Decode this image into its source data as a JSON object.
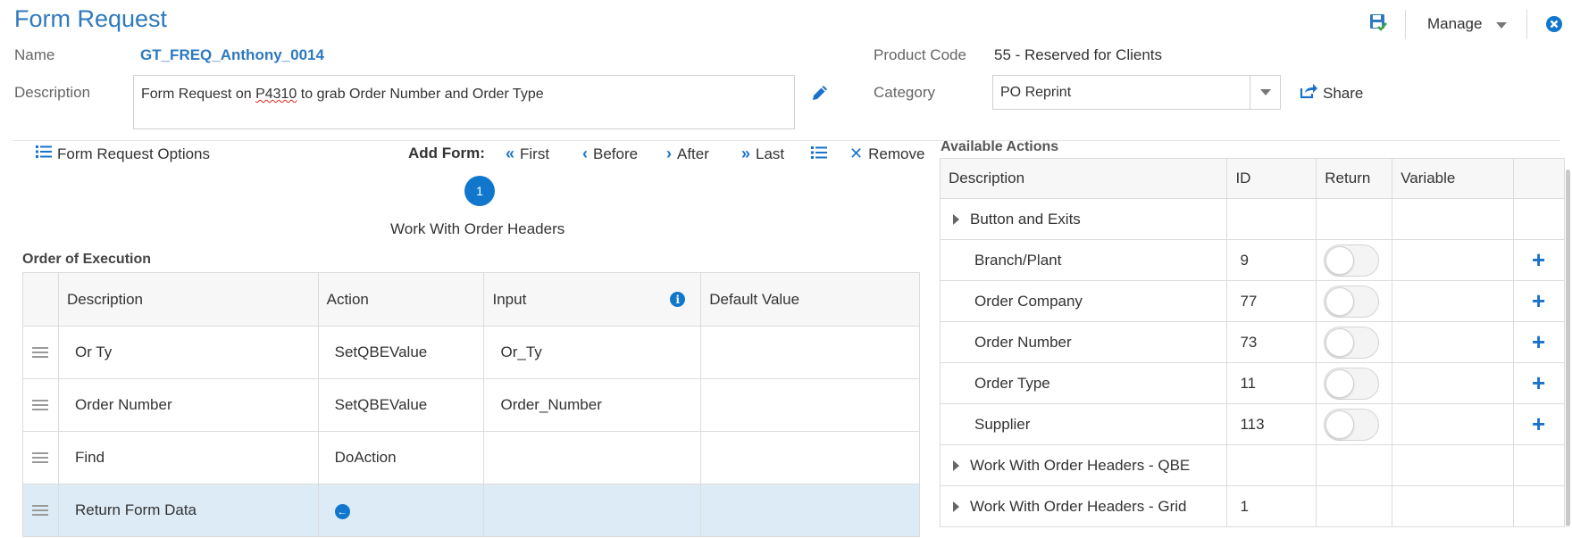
{
  "header": {
    "title": "Form Request",
    "manage_label": "Manage",
    "name_label": "Name",
    "name_value": "GT_FREQ_Anthony_0014",
    "description_label": "Description",
    "description_pre": "Form Request on ",
    "description_spell": "P4310",
    "description_post": " to grab Order Number and Order Type",
    "product_code_label": "Product Code",
    "product_code_value": "55 - Reserved for Clients",
    "category_label": "Category",
    "category_value": "PO Reprint",
    "share_label": "Share"
  },
  "toolbar": {
    "options_label": "Form Request Options",
    "add_form_label": "Add Form:",
    "first_label": "First",
    "before_label": "Before",
    "after_label": "After",
    "last_label": "Last",
    "remove_label": "Remove"
  },
  "form_step": {
    "number": "1",
    "name": "Work With Order Headers"
  },
  "order_of_execution": {
    "title": "Order of Execution",
    "columns": [
      "Description",
      "Action",
      "Input",
      "Default Value"
    ],
    "rows": [
      {
        "description": "Or Ty",
        "action": "SetQBEValue",
        "input": "Or_Ty",
        "default": ""
      },
      {
        "description": "Order Number",
        "action": "SetQBEValue",
        "input": "Order_Number",
        "default": ""
      },
      {
        "description": "Find",
        "action": "DoAction",
        "input": "",
        "default": ""
      },
      {
        "description": "Return Form Data",
        "action": "",
        "input": "",
        "default": ""
      }
    ]
  },
  "available_actions": {
    "title": "Available Actions",
    "columns": [
      "Description",
      "ID",
      "Return",
      "Variable"
    ],
    "groups": [
      {
        "label": "Button and Exits",
        "id": ""
      },
      {
        "label": "Work With Order Headers - QBE",
        "id": ""
      },
      {
        "label": "Work With Order Headers - Grid",
        "id": "1"
      }
    ],
    "items": [
      {
        "description": "Branch/Plant",
        "id": "9"
      },
      {
        "description": "Order Company",
        "id": "77"
      },
      {
        "description": "Order Number",
        "id": "73"
      },
      {
        "description": "Order Type",
        "id": "11"
      },
      {
        "description": "Supplier",
        "id": "113"
      }
    ]
  },
  "colors": {
    "accent": "#2e79bf",
    "selected_row": "#ddebf6"
  }
}
